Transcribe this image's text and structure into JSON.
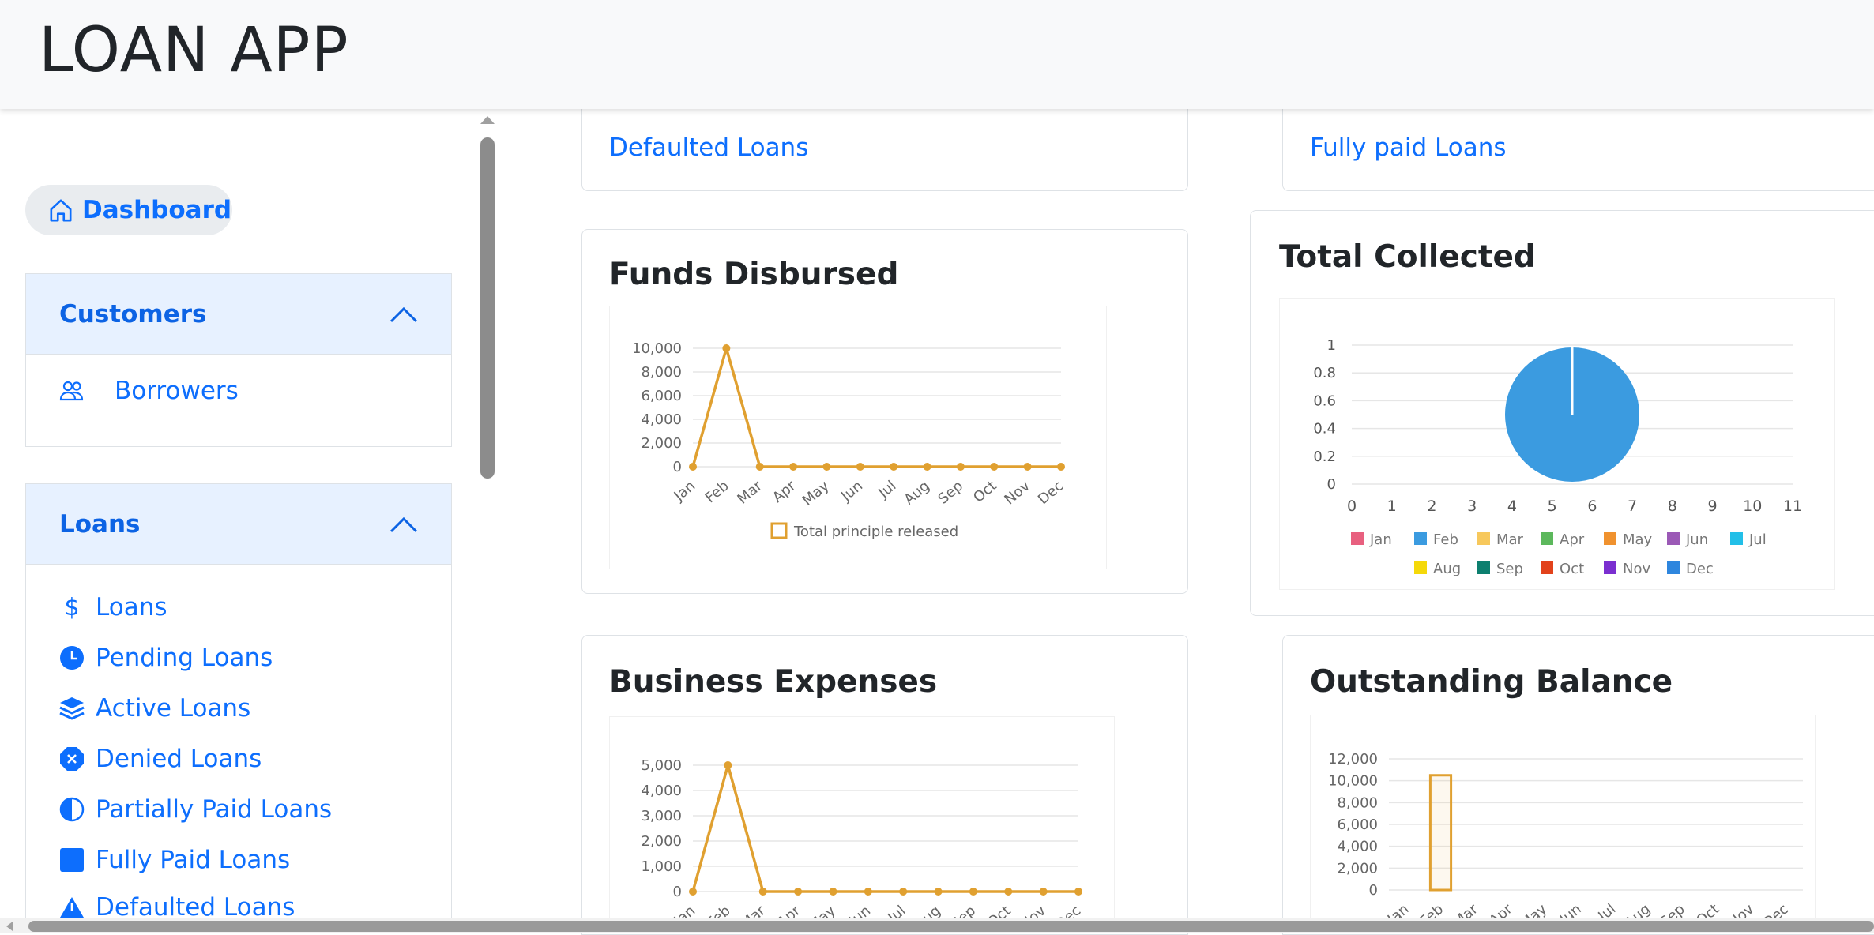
{
  "header": {
    "title": "LOAN APP"
  },
  "sidebar": {
    "dashboard_label": "Dashboard",
    "customers": {
      "label": "Customers",
      "items": [
        {
          "label": "Borrowers",
          "icon": "people-icon"
        }
      ]
    },
    "loans": {
      "label": "Loans",
      "items": [
        {
          "label": "Loans",
          "icon": "dollar-icon"
        },
        {
          "label": "Pending Loans",
          "icon": "clock-icon"
        },
        {
          "label": "Active Loans",
          "icon": "layers-icon"
        },
        {
          "label": "Denied Loans",
          "icon": "x-octagon-icon"
        },
        {
          "label": "Partially Paid Loans",
          "icon": "circle-half-icon"
        },
        {
          "label": "Fully Paid Loans",
          "icon": "square-icon"
        },
        {
          "label": "Defaulted Loans",
          "icon": "warning-icon"
        }
      ]
    }
  },
  "cards": {
    "defaulted_link": "Defaulted Loans",
    "fully_paid_link": "Fully paid Loans",
    "funds_title": "Funds Disbursed",
    "collected_title": "Total Collected",
    "expenses_title": "Business Expenses",
    "outstanding_title": "Outstanding Balance"
  },
  "chart_data": [
    {
      "id": "funds",
      "type": "line",
      "categories": [
        "Jan",
        "Feb",
        "Mar",
        "Apr",
        "May",
        "Jun",
        "Jul",
        "Aug",
        "Sep",
        "Oct",
        "Nov",
        "Dec"
      ],
      "series": [
        {
          "name": "Total principle released",
          "values": [
            0,
            10000,
            0,
            0,
            0,
            0,
            0,
            0,
            0,
            0,
            0,
            0
          ]
        }
      ],
      "yticks": [
        "10,000",
        "8,000",
        "6,000",
        "4,000",
        "2,000",
        "0"
      ],
      "ylim": [
        0,
        10000
      ],
      "color": "#e0a030",
      "legend": "bottom"
    },
    {
      "id": "collected",
      "type": "pie",
      "categories": [
        "Jan",
        "Feb",
        "Mar",
        "Apr",
        "May",
        "Jun",
        "Jul",
        "Aug",
        "Sep",
        "Oct",
        "Nov",
        "Dec"
      ],
      "values": [
        0,
        1,
        0,
        0,
        0,
        0,
        0,
        0,
        0,
        0,
        0,
        0
      ],
      "colors": [
        "#e8607f",
        "#3b9be0",
        "#f7c85c",
        "#5cb85c",
        "#f0922e",
        "#9b59b6",
        "#22bfe8",
        "#f5d90a",
        "#0d7f6f",
        "#e2421b",
        "#7b2fd0",
        "#2e86de"
      ],
      "xticks": [
        "0",
        "1",
        "2",
        "3",
        "4",
        "5",
        "6",
        "7",
        "8",
        "9",
        "10",
        "11"
      ],
      "yticks": [
        "1",
        "0.8",
        "0.6",
        "0.4",
        "0.2",
        "0"
      ],
      "legend": "bottom"
    },
    {
      "id": "expenses",
      "type": "line",
      "categories": [
        "Jan",
        "Feb",
        "Mar",
        "Apr",
        "May",
        "Jun",
        "Jul",
        "Aug",
        "Sep",
        "Oct",
        "Nov",
        "Dec"
      ],
      "series": [
        {
          "values": [
            0,
            5000,
            0,
            0,
            0,
            0,
            0,
            0,
            0,
            0,
            0,
            0
          ]
        }
      ],
      "yticks": [
        "5,000",
        "4,000",
        "3,000",
        "2,000",
        "1,000",
        "0"
      ],
      "ylim": [
        0,
        5000
      ],
      "color": "#e0a030"
    },
    {
      "id": "outstanding",
      "type": "bar",
      "categories": [
        "Jan",
        "Feb",
        "Mar",
        "Apr",
        "May",
        "Jun",
        "Jul",
        "Aug",
        "Sep",
        "Oct",
        "Nov",
        "Dec"
      ],
      "values": [
        0,
        10500,
        0,
        0,
        0,
        0,
        0,
        0,
        0,
        0,
        0,
        0
      ],
      "yticks": [
        "12,000",
        "10,000",
        "8,000",
        "6,000",
        "4,000",
        "2,000",
        "0"
      ],
      "ylim": [
        0,
        12000
      ],
      "color": "#e0a030"
    }
  ]
}
